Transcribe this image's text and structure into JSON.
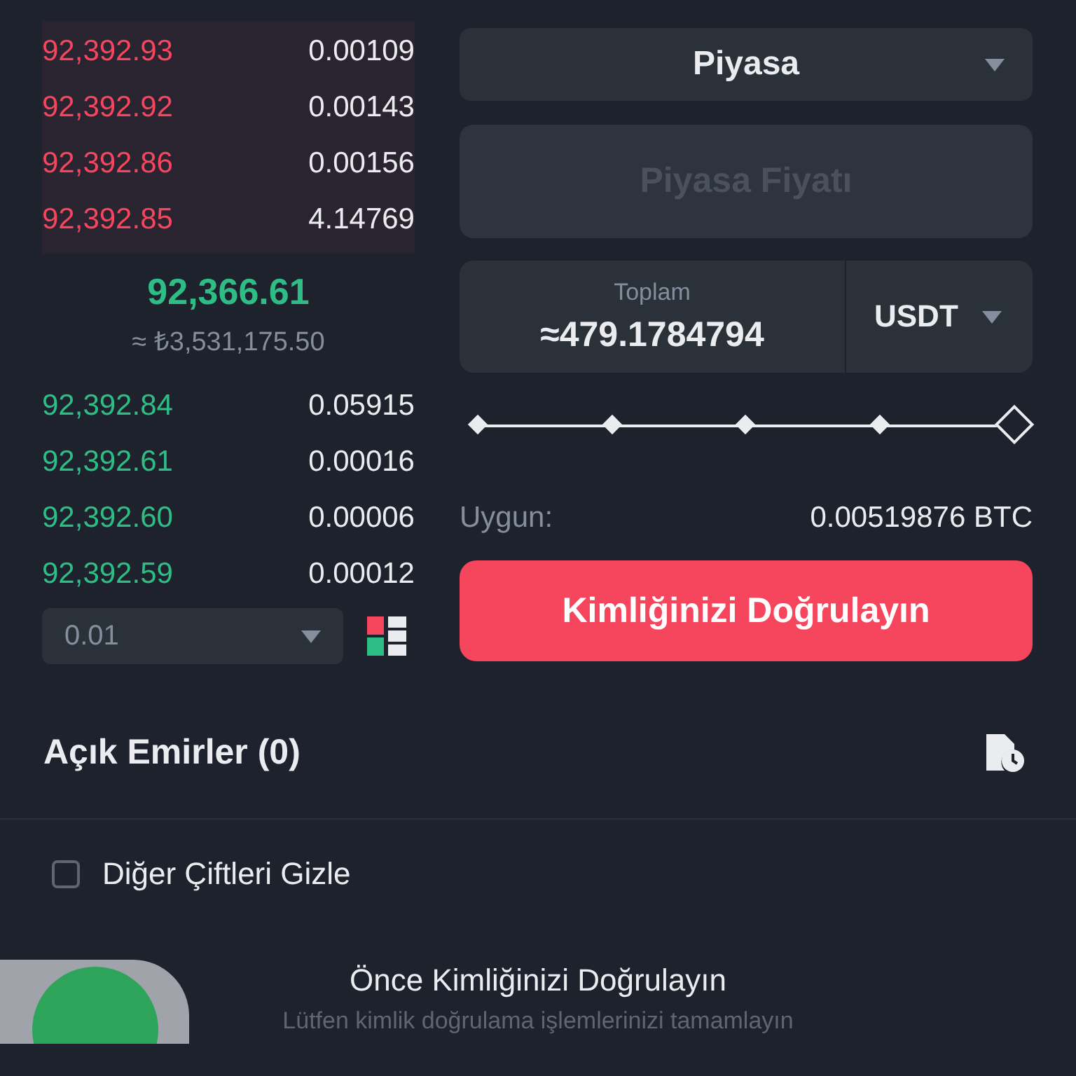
{
  "order_book": {
    "asks": [
      {
        "price": "92,392.93",
        "amount": "0.00109"
      },
      {
        "price": "92,392.92",
        "amount": "0.00143"
      },
      {
        "price": "92,392.86",
        "amount": "0.00156"
      },
      {
        "price": "92,392.85",
        "amount": "4.14769"
      }
    ],
    "last_price": "92,366.61",
    "last_price_fiat": "≈ ₺3,531,175.50",
    "bids": [
      {
        "price": "92,392.84",
        "amount": "0.05915"
      },
      {
        "price": "92,392.61",
        "amount": "0.00016"
      },
      {
        "price": "92,392.60",
        "amount": "0.00006"
      },
      {
        "price": "92,392.59",
        "amount": "0.00012"
      }
    ],
    "precision": "0.01"
  },
  "order_form": {
    "order_type": "Piyasa",
    "price_placeholder": "Piyasa Fiyatı",
    "total": {
      "label": "Toplam",
      "value": "≈479.1784794",
      "unit": "USDT"
    },
    "slider": {
      "level": 1
    },
    "available": {
      "label": "Uygun:",
      "value": "0.00519876 BTC"
    },
    "submit": "Kimliğinizi Doğrulayın"
  },
  "open_orders": {
    "title": "Açık Emirler (0)",
    "hide_other_pairs": {
      "label": "Diğer Çiftleri Gizle",
      "checked": false
    },
    "empty_title": "Önce Kimliğinizi Doğrulayın",
    "empty_text": "Lütfen kimlik doğrulama işlemlerinizi tamamlayın"
  }
}
